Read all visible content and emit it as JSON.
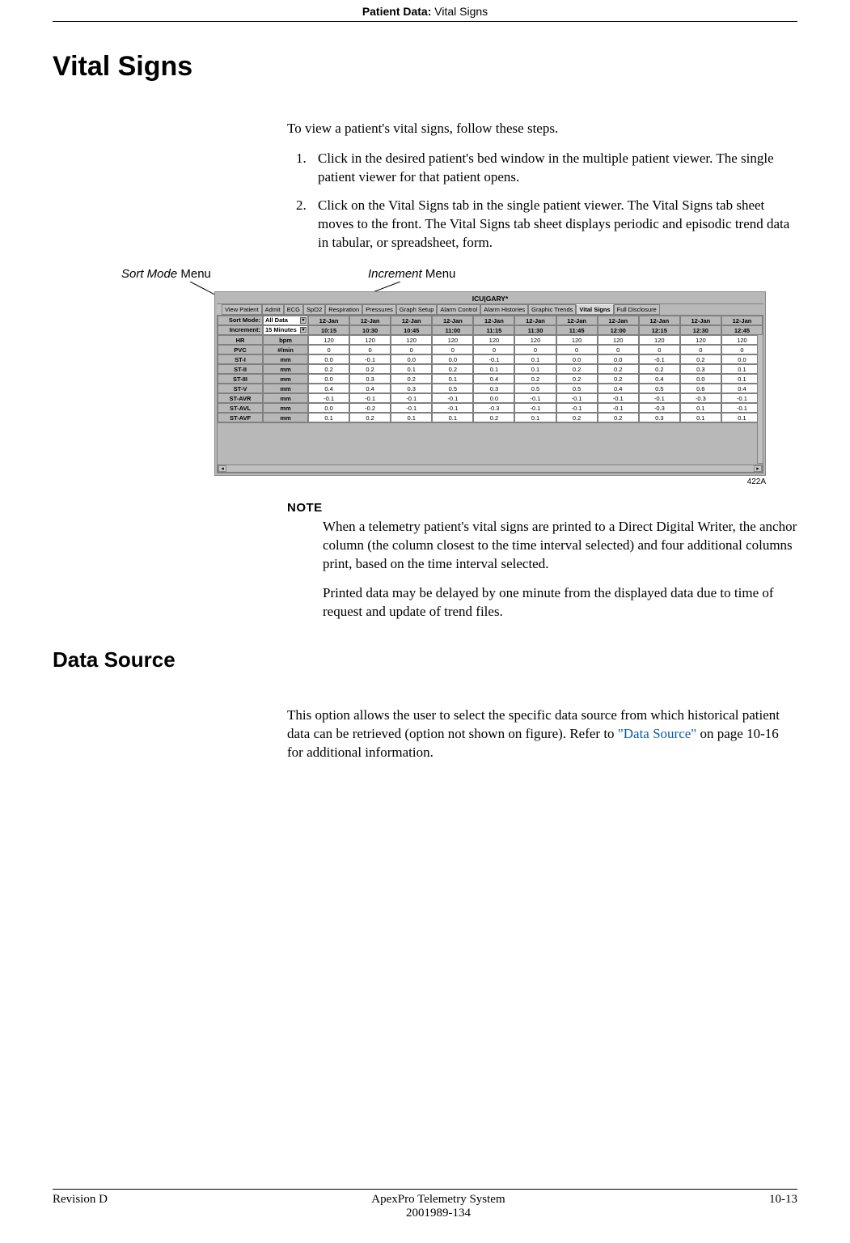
{
  "header": {
    "bold": "Patient Data:",
    "rest": " Vital Signs"
  },
  "h1": "Vital Signs",
  "intro": "To view a patient's vital signs, follow these steps.",
  "steps": [
    "Click in the desired patient's bed window in the multiple patient viewer. The single patient viewer for that patient opens.",
    "Click on the Vital Signs tab in the single patient viewer. The Vital Signs tab sheet moves to the front. The Vital Signs tab sheet displays periodic and episodic trend data in tabular, or spreadsheet, form."
  ],
  "callout_sort_it": "Sort Mode",
  "callout_sort_nm": " Menu",
  "callout_inc_it": "Increment",
  "callout_inc_nm": " Menu",
  "shot": {
    "title": "ICU|GARY*",
    "tabs": [
      "View Patient",
      "Admit",
      "ECG",
      "SpO2",
      "Respiration",
      "Pressures",
      "Graph Setup",
      "Alarm Control",
      "Alarm Histories",
      "Graphic Trends",
      "Vital Signs",
      "Full Disclosure"
    ],
    "active_tab_index": 10,
    "sort_label": "Sort Mode:",
    "sort_value": "All Data",
    "inc_label": "Increment:",
    "inc_value": "15 Minutes",
    "dates": [
      "12-Jan",
      "12-Jan",
      "12-Jan",
      "12-Jan",
      "12-Jan",
      "12-Jan",
      "12-Jan",
      "12-Jan",
      "12-Jan",
      "12-Jan",
      "12-Jan"
    ],
    "times": [
      "10:15",
      "10:30",
      "10:45",
      "11:00",
      "11:15",
      "11:30",
      "11:45",
      "12:00",
      "12:15",
      "12:30",
      "12:45"
    ],
    "rows": [
      {
        "param": "HR",
        "unit": "bpm",
        "vals": [
          "120",
          "120",
          "120",
          "120",
          "120",
          "120",
          "120",
          "120",
          "120",
          "120",
          "120"
        ]
      },
      {
        "param": "PVC",
        "unit": "#/min",
        "vals": [
          "0",
          "0",
          "0",
          "0",
          "0",
          "0",
          "0",
          "0",
          "0",
          "0",
          "0"
        ]
      },
      {
        "param": "ST-I",
        "unit": "mm",
        "vals": [
          "0.0",
          "-0.1",
          "0.0",
          "0.0",
          "-0.1",
          "0.1",
          "0.0",
          "0.0",
          "-0.1",
          "0.2",
          "0.0"
        ]
      },
      {
        "param": "ST-II",
        "unit": "mm",
        "vals": [
          "0.2",
          "0.2",
          "0.1",
          "0.2",
          "0.1",
          "0.1",
          "0.2",
          "0.2",
          "0.2",
          "0.3",
          "0.1"
        ]
      },
      {
        "param": "ST-III",
        "unit": "mm",
        "vals": [
          "0.0",
          "0.3",
          "0.2",
          "0.1",
          "0.4",
          "0.2",
          "0.2",
          "0.2",
          "0.4",
          "0.0",
          "0.1"
        ]
      },
      {
        "param": "ST-V",
        "unit": "mm",
        "vals": [
          "0.4",
          "0.4",
          "0.3",
          "0.5",
          "0.3",
          "0.5",
          "0.5",
          "0.4",
          "0.5",
          "0.6",
          "0.4"
        ]
      },
      {
        "param": "ST-AVR",
        "unit": "mm",
        "vals": [
          "-0.1",
          "-0.1",
          "-0.1",
          "-0.1",
          "0.0",
          "-0.1",
          "-0.1",
          "-0.1",
          "-0.1",
          "-0.3",
          "-0.1"
        ]
      },
      {
        "param": "ST-AVL",
        "unit": "mm",
        "vals": [
          "0.0",
          "-0.2",
          "-0.1",
          "-0.1",
          "-0.3",
          "-0.1",
          "-0.1",
          "-0.1",
          "-0.3",
          "0.1",
          "-0.1"
        ]
      },
      {
        "param": "ST-AVF",
        "unit": "mm",
        "vals": [
          "0.1",
          "0.2",
          "0.1",
          "0.1",
          "0.2",
          "0.1",
          "0.2",
          "0.2",
          "0.3",
          "0.1",
          "0.1"
        ]
      }
    ]
  },
  "img_num": "422A",
  "note_label": "NOTE",
  "note_p1": "When a telemetry patient's vital signs are printed to a Direct Digital Writer, the anchor column (the column closest to the time interval selected) and four additional columns print, based on the time interval selected.",
  "note_p2": "Printed data may be delayed by one minute from the displayed data due to time of request and update of trend files.",
  "h2": "Data Source",
  "ds_pre": "This option allows the user to select the specific data source from which historical patient data can be retrieved (option not  shown on figure). Refer to ",
  "ds_link": "\"Data Source\"",
  "ds_post": " on page 10-16 for additional information.",
  "footer": {
    "left": "Revision D",
    "center1": "ApexPro Telemetry System",
    "center2": "2001989-134",
    "right": "10-13"
  }
}
